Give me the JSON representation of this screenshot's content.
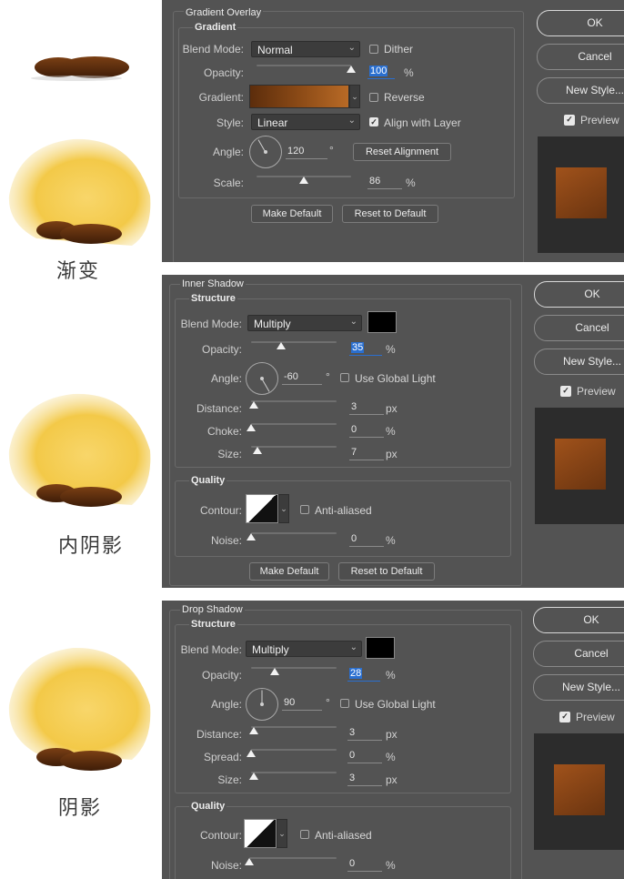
{
  "illustration": {
    "caption1": "渐变",
    "caption2": "内阴影",
    "caption3": "阴影"
  },
  "panel1": {
    "title": "Gradient Overlay",
    "group": "Gradient",
    "blend_mode_label": "Blend Mode:",
    "blend_mode_value": "Normal",
    "dither_label": "Dither",
    "opacity_label": "Opacity:",
    "opacity_value": "100",
    "opacity_unit": "%",
    "opacity_level": 1.0,
    "gradient_label": "Gradient:",
    "reverse_label": "Reverse",
    "style_label": "Style:",
    "style_value": "Linear",
    "align_label": "Align with Layer",
    "angle_label": "Angle:",
    "angle_value": "120",
    "angle_unit": "°",
    "reset_alignment": "Reset Alignment",
    "scale_label": "Scale:",
    "scale_value": "86",
    "scale_unit": "%",
    "make_default": "Make Default",
    "reset_default": "Reset to Default"
  },
  "panel2": {
    "title": "Inner Shadow",
    "group": "Structure",
    "blend_mode_label": "Blend Mode:",
    "blend_mode_value": "Multiply",
    "opacity_label": "Opacity:",
    "opacity_value": "35",
    "opacity_unit": "%",
    "angle_label": "Angle:",
    "angle_value": "-60",
    "angle_unit": "°",
    "global_light_label": "Use Global Light",
    "distance_label": "Distance:",
    "distance_value": "3",
    "distance_unit": "px",
    "choke_label": "Choke:",
    "choke_value": "0",
    "choke_unit": "%",
    "size_label": "Size:",
    "size_value": "7",
    "size_unit": "px",
    "quality_group": "Quality",
    "contour_label": "Contour:",
    "antialiased_label": "Anti-aliased",
    "noise_label": "Noise:",
    "noise_value": "0",
    "noise_unit": "%",
    "make_default": "Make Default",
    "reset_default": "Reset to Default"
  },
  "panel3": {
    "title": "Drop Shadow",
    "group": "Structure",
    "blend_mode_label": "Blend Mode:",
    "blend_mode_value": "Multiply",
    "opacity_label": "Opacity:",
    "opacity_value": "28",
    "opacity_unit": "%",
    "angle_label": "Angle:",
    "angle_value": "90",
    "angle_unit": "°",
    "global_light_label": "Use Global Light",
    "distance_label": "Distance:",
    "distance_value": "3",
    "distance_unit": "px",
    "spread_label": "Spread:",
    "spread_value": "0",
    "spread_unit": "%",
    "size_label": "Size:",
    "size_value": "3",
    "size_unit": "px",
    "quality_group": "Quality",
    "contour_label": "Contour:",
    "antialiased_label": "Anti-aliased",
    "noise_label": "Noise:",
    "noise_value": "0",
    "noise_unit": "%"
  },
  "side_buttons": {
    "ok": "OK",
    "cancel": "Cancel",
    "new_style": "New Style...",
    "preview": "Preview"
  },
  "colors": {
    "panel_bg": "#535353",
    "field_bg": "#3c3c3c",
    "selection_blue": "#2a6fd0",
    "swatch_brown": "#8b4a16",
    "fur_yellow": "#f3c948"
  }
}
